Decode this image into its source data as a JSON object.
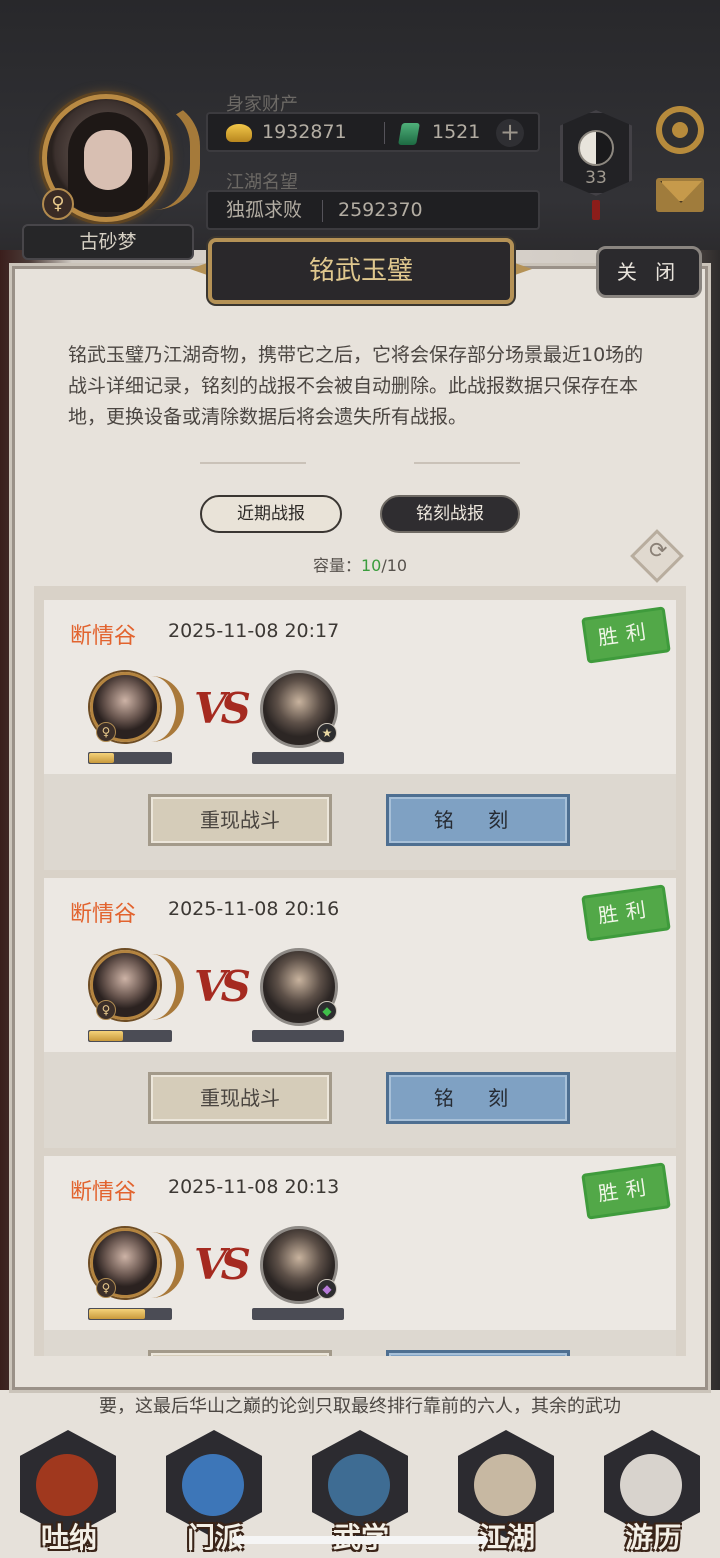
{
  "header": {
    "wealth_label": "身家财产",
    "gold": "1932871",
    "jade": "1521",
    "reputation_label": "江湖名望",
    "title": "独孤求败",
    "reputation": "2592370",
    "player_name": "古砂梦",
    "sex_symbol": "♀",
    "level": "33",
    "plus": "+"
  },
  "dialog": {
    "title": "铭武玉璧",
    "close_label": "关 闭",
    "description": "铭武玉璧乃江湖奇物，携带它之后，它将会保存部分场景最近10场的战斗详细记录，铭刻的战报不会被自动删除。此战报数据只保存在本地，更换设备或清除数据后将会遗失所有战报。",
    "tabs": [
      "近期战报",
      "铭刻战报"
    ],
    "capacity_label": "容量：",
    "capacity_used": "10",
    "capacity_total": "/10",
    "vs": "VS",
    "replay_label": "重现战斗",
    "engrave_label": "铭 刻",
    "result_label": "胜利",
    "records": [
      {
        "location": "断情谷",
        "time": "2025-11-08 20:17",
        "player_hp": 0.3,
        "enemy_rank": "★",
        "enemy_rank_color": "#e9d9a3"
      },
      {
        "location": "断情谷",
        "time": "2025-11-08 20:16",
        "player_hp": 0.42,
        "enemy_rank": "◆",
        "enemy_rank_color": "#3fbf4a"
      },
      {
        "location": "断情谷",
        "time": "2025-11-08 20:13",
        "player_hp": 0.68,
        "enemy_rank": "◆",
        "enemy_rank_color": "#b67ad8"
      }
    ]
  },
  "background_text": "要，这最后华山之巅的论剑只取最终排行靠前的六人，其余的武功",
  "nav": [
    {
      "label": "吐纳",
      "icon": "roast-chicken-icon",
      "color": "#a0381e"
    },
    {
      "label": "门派",
      "icon": "flags-icon",
      "color": "#3d76b8"
    },
    {
      "label": "武学",
      "icon": "books-icon",
      "color": "#3e6c93"
    },
    {
      "label": "江湖",
      "icon": "hat-icon",
      "color": "#c7b8a2"
    },
    {
      "label": "游历",
      "icon": "horse-icon",
      "color": "#d8d3cd"
    }
  ]
}
